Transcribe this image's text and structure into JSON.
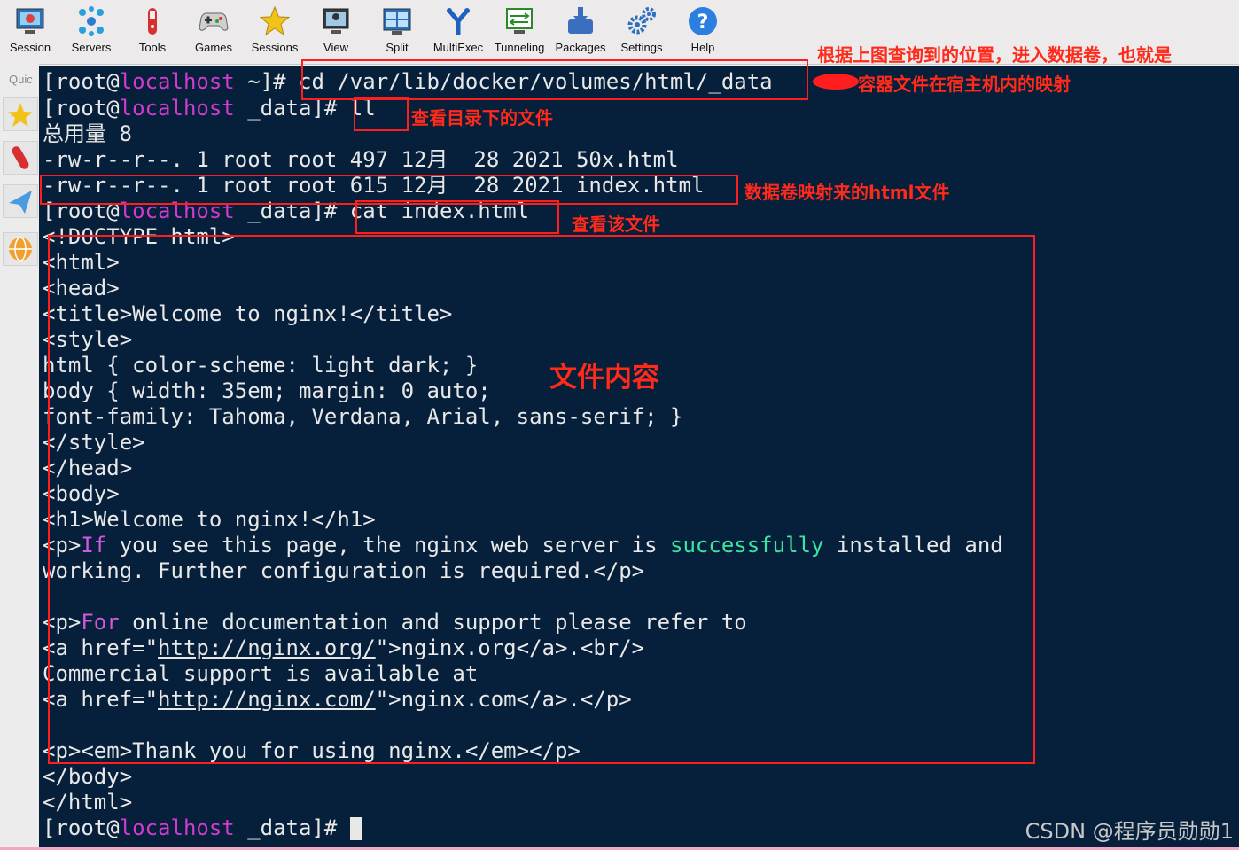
{
  "toolbar": {
    "items": [
      {
        "label": "Session",
        "icon": "session-monitor-icon"
      },
      {
        "label": "Servers",
        "icon": "servers-network-icon"
      },
      {
        "label": "Tools",
        "icon": "tools-knife-icon"
      },
      {
        "label": "Games",
        "icon": "games-gamepad-icon"
      },
      {
        "label": "Sessions",
        "icon": "sessions-star-icon"
      },
      {
        "label": "View",
        "icon": "view-monitor-icon"
      },
      {
        "label": "Split",
        "icon": "split-grid-icon"
      },
      {
        "label": "MultiExec",
        "icon": "multiexec-fork-icon"
      },
      {
        "label": "Tunneling",
        "icon": "tunneling-icon"
      },
      {
        "label": "Packages",
        "icon": "packages-download-icon"
      },
      {
        "label": "Settings",
        "icon": "settings-gears-icon"
      },
      {
        "label": "Help",
        "icon": "help-question-icon"
      }
    ]
  },
  "sidebar": {
    "quick_label": "Quic",
    "icons": [
      "favorites-star-icon",
      "tools-knife-icon",
      "send-arrow-icon",
      "globe-icon"
    ]
  },
  "terminal": {
    "prompt_user": "[root@",
    "prompt_host": "localhost",
    "line1": {
      "dir": " ~]# ",
      "cmd": "cd /var/lib/docker/volumes/html/_data"
    },
    "line2": {
      "dir": " _data]# ",
      "cmd": "ll"
    },
    "line3": "总用量 8",
    "line4": "-rw-r--r--. 1 root root 497 12月  28 2021 50x.html",
    "line5": "-rw-r--r--. 1 root root 615 12月  28 2021 index.html",
    "line6": {
      "dir": " _data]# ",
      "cmd": "cat index.html"
    },
    "html_lines": [
      "<!DOCTYPE html>",
      "<html>",
      "<head>",
      "<title>Welcome to nginx!</title>",
      "<style>",
      "html { color-scheme: light dark; }",
      "body { width: 35em; margin: 0 auto;",
      "font-family: Tahoma, Verdana, Arial, sans-serif; }",
      "</style>",
      "</head>",
      "<body>",
      "<h1>Welcome to nginx!</h1>"
    ],
    "p1": {
      "a": "<p>",
      "b": "If",
      "c": " you see this page, the nginx web server is ",
      "d": "successfully",
      "e": " installed and"
    },
    "p1b": "working. Further configuration is required.</p>",
    "p2": {
      "a": "<p>",
      "b": "For",
      "c": " online documentation and support please refer to"
    },
    "a1": {
      "a": "<a href=\"",
      "b": "http://nginx.org/",
      "c": "\">nginx.org</a>.<br/>"
    },
    "commercial": "Commercial support is available at",
    "a2": {
      "a": "<a href=\"",
      "b": "http://nginx.com/",
      "c": "\">nginx.com</a>.</p>"
    },
    "thanks": "<p><em>Thank you for using nginx.</em></p>",
    "end_body": "</body>",
    "end_html": "</html>",
    "last_prompt_dir": " _data]# "
  },
  "annotations": {
    "cd_note_1": "根据上图查询到的位置，进入数据卷，也就是",
    "cd_note_2": "容器文件在宿主机内的映射",
    "ll_note": "查看目录下的文件",
    "index_note": "数据卷映射来的html文件",
    "cat_note": "查看该文件",
    "content_note": "文件内容"
  },
  "watermark": "CSDN @程序员勋勋1",
  "colors": {
    "terminal_bg": "#061f3a",
    "host": "#d23ad0",
    "annotation_red": "#ff1e1e",
    "keyword_green": "#3ce6a0",
    "keyword_purple": "#d05ae0"
  }
}
